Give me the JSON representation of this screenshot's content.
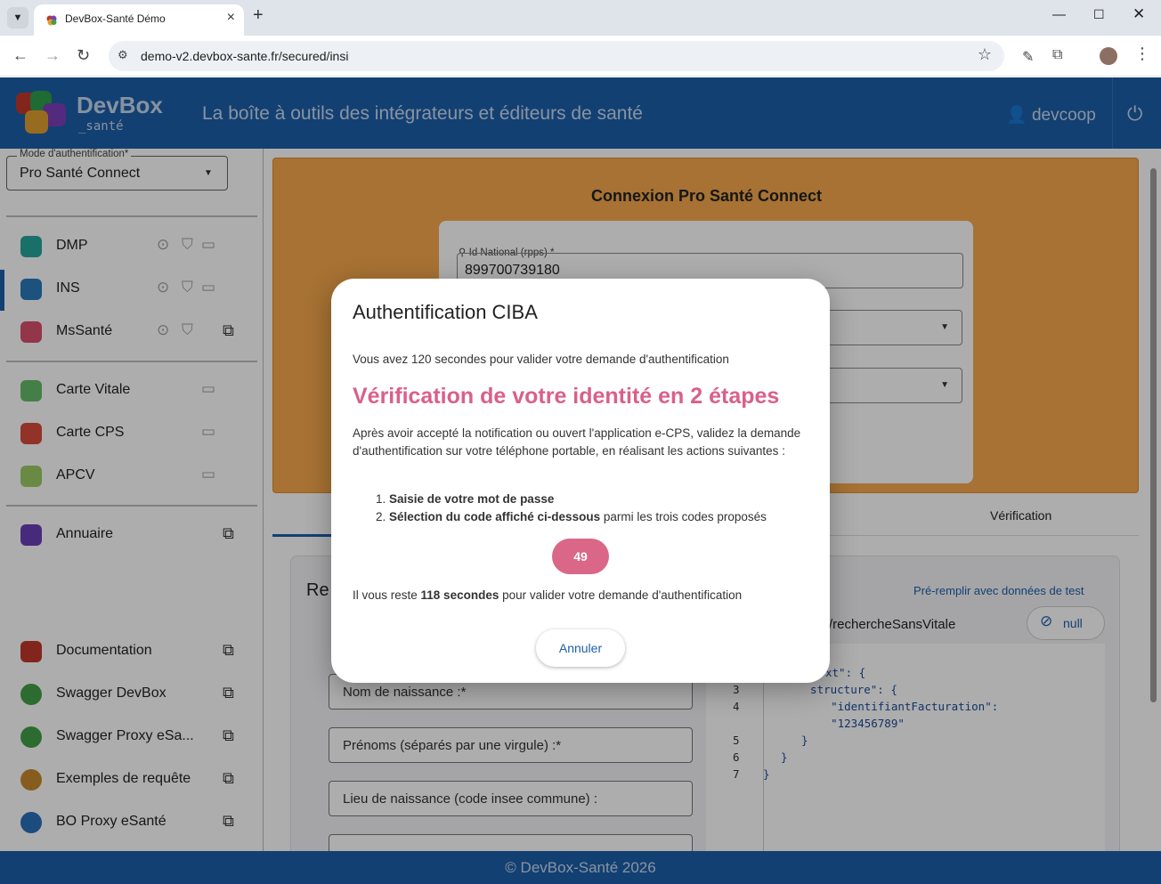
{
  "browser": {
    "tab_title": "DevBox-Santé Démo",
    "url": "demo-v2.devbox-sante.fr/secured/insi"
  },
  "header": {
    "brand_main": "DevBox",
    "brand_sub": "_santé",
    "tagline": "La boîte à outils des intégrateurs et éditeurs de santé",
    "user": "devcoop"
  },
  "sidebar": {
    "auth_label": "Mode d'authentification*",
    "auth_value": "Pro Santé Connect",
    "items": [
      {
        "label": "DMP",
        "color": "#26a69a"
      },
      {
        "label": "INS",
        "color": "#2a7ab8"
      },
      {
        "label": "MsSanté",
        "color": "#d9506e"
      },
      {
        "label": "Carte Vitale",
        "color": "#66bb6a"
      },
      {
        "label": "Carte CPS",
        "color": "#d84b3c"
      },
      {
        "label": "APCV",
        "color": "#9ccc65"
      },
      {
        "label": "Annuaire",
        "color": "#6a3fb8"
      },
      {
        "label": "Documentation",
        "color": "#c0392b"
      },
      {
        "label": "Swagger DevBox",
        "color": "#43a047"
      },
      {
        "label": "Swagger Proxy eSa...",
        "color": "#43a047"
      },
      {
        "label": "Exemples de requête",
        "color": "#c78a2e"
      },
      {
        "label": "BO Proxy eSanté",
        "color": "#2a6fb8"
      }
    ]
  },
  "main": {
    "psc_title": "Connexion Pro Santé Connect",
    "rpps_label": "Id National (rpps) *",
    "rpps_value": "899700739180",
    "tab_verification": "Vérification",
    "request_title": "Re",
    "prefill_link": "Pré-remplir avec données de test",
    "path_text": "/rechercheSansVitale",
    "null_label": "null",
    "fields": [
      "Nom de naissance :*",
      "Prénoms (séparés par une virgule) :*",
      "Lieu de naissance (code insee commune) :"
    ],
    "code_lines": [
      {
        "n": "",
        "text": "xt\": {"
      },
      {
        "n": "3",
        "text": "  structure\": {"
      },
      {
        "n": "4",
        "text": "    \"identifiantFacturation\":"
      },
      {
        "n": "",
        "text": "    \"123456789\""
      },
      {
        "n": "5",
        "text": "  }"
      },
      {
        "n": "6",
        "text": "}"
      },
      {
        "n": "7",
        "text": "}"
      }
    ]
  },
  "footer": {
    "text": "© DevBox-Santé 2026"
  },
  "dialog": {
    "title": "Authentification CIBA",
    "intro": "Vous avez 120 secondes pour valider votre demande d'authentification",
    "heading": "Vérification de votre identité en 2 étapes",
    "body": "Après avoir accepté la notification ou ouvert l'application e-CPS, validez la demande d'authentification sur votre téléphone portable, en réalisant les actions suivantes :",
    "step1_bold": "Saisie de votre mot de passe",
    "step2_bold": "Sélection du code affiché ci-dessous",
    "step2_rest": " parmi les trois codes proposés",
    "code": "49",
    "remaining_prefix": "Il vous reste ",
    "remaining_bold": "118 secondes",
    "remaining_suffix": " pour valider votre demande d'authentification",
    "cancel": "Annuler"
  }
}
